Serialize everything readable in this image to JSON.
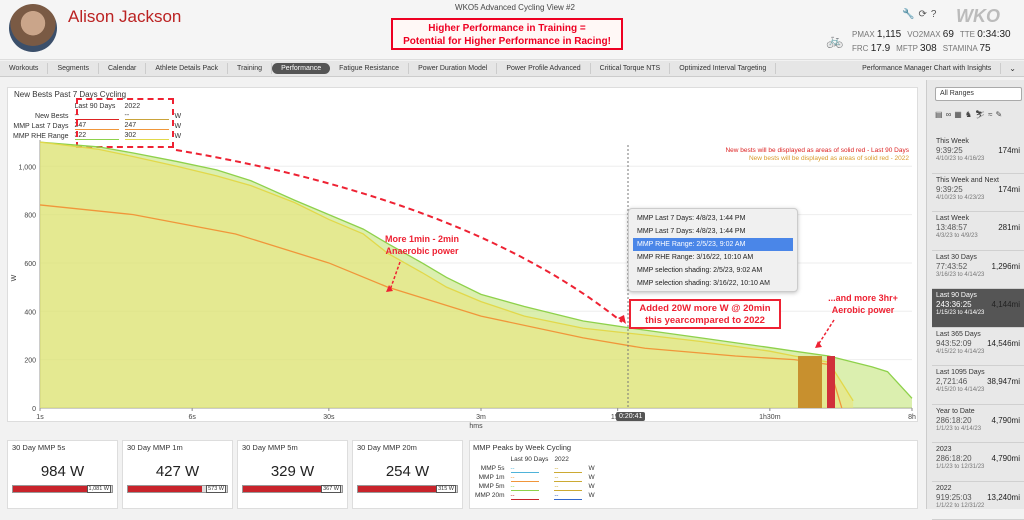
{
  "window_title": "WKO5 Advanced Cycling View #2",
  "athlete": {
    "name": "Alison Jackson"
  },
  "headline": {
    "line1": "Higher Performance in Training =",
    "line2": "Potential for Higher Performance in Racing!"
  },
  "logo": "WKO",
  "metrics": [
    {
      "label": "PMAX",
      "value": "1,115"
    },
    {
      "label": "VO2MAX",
      "value": "69"
    },
    {
      "label": "TTE",
      "value": "0:34:30"
    },
    {
      "label": "FRC",
      "value": "17.9"
    },
    {
      "label": "MFTP",
      "value": "308"
    },
    {
      "label": "STAMINA",
      "value": "75"
    }
  ],
  "tabs": [
    "Workouts",
    "Segments",
    "Calendar",
    "Athlete Details Pack",
    "Training",
    "Performance",
    "Fatigue Resistance",
    "Power Duration Model",
    "Power Profile Advanced",
    "Critical Torque NTS",
    "Optimized Interval Targeting",
    "Performance Manager Chart with Insights"
  ],
  "active_tab": "Performance",
  "main_chart": {
    "panel_title": "New Bests Past 7 Days Cycling",
    "legend": {
      "col1": "Last 90 Days",
      "col2": "2022",
      "rows": [
        {
          "label": "New Bests",
          "v1": "--",
          "v2": "--",
          "unit": "W"
        },
        {
          "label": "MMP Last 7 Days",
          "v1": "247",
          "v2": "247",
          "unit": "W"
        },
        {
          "label": "MMP RHE Range",
          "v1": "322",
          "v2": "302",
          "unit": "W"
        }
      ]
    },
    "notes": [
      "New bests will be displayed as areas of solid red - Last 90 Days",
      "New bests will be displayed as areas of solid red - 2022"
    ],
    "annotations": {
      "anaerobic": [
        "More 1min - 2min",
        "Anaerobic power"
      ],
      "threshold": [
        "Added 20W more W @ 20min",
        "this yearcompared to 2022"
      ],
      "aerobic": [
        "...and more 3hr+",
        "Aerobic power"
      ]
    },
    "tooltip_items": [
      "MMP Last 7 Days: 4/8/23, 1:44 PM",
      "MMP Last 7 Days: 4/8/23, 1:44 PM",
      "MMP RHE Range: 2/5/23, 9:02 AM",
      "MMP RHE Range: 3/16/22, 10:10 AM",
      "MMP selection shading: 2/5/23, 9:02 AM",
      "MMP selection shading: 3/16/22, 10:10 AM"
    ],
    "tooltip_selected": 2,
    "cursor_time": "0:20:41"
  },
  "chart_data": {
    "type": "area",
    "xlabel": "hms",
    "ylabel": "W",
    "x_ticks": [
      "1s",
      "6s",
      "30s",
      "3m",
      "15m",
      "1h30m",
      "8h"
    ],
    "y_ticks": [
      "0",
      "200",
      "400",
      "600",
      "800",
      "1,000"
    ],
    "ylim": [
      0,
      1150
    ],
    "x_log_seconds": [
      1,
      28800
    ],
    "series": [
      {
        "name": "MMP RHE Range - Last 90 Days",
        "color": "#8ed14b",
        "x": [
          1,
          2,
          3,
          5,
          8,
          12,
          20,
          30,
          45,
          60,
          90,
          120,
          180,
          300,
          600,
          1241,
          2400,
          3600,
          5400,
          7200,
          10800,
          14400,
          18000,
          21600,
          28800
        ],
        "y": [
          1100,
          1080,
          1055,
          1020,
          985,
          940,
          860,
          800,
          740,
          680,
          600,
          540,
          470,
          420,
          360,
          322,
          290,
          270,
          250,
          235,
          215,
          190,
          170,
          150,
          40
        ]
      },
      {
        "name": "MMP RHE Range - 2022",
        "color": "#e2d84a",
        "x": [
          1,
          2,
          3,
          5,
          8,
          12,
          20,
          30,
          45,
          60,
          90,
          120,
          180,
          300,
          600,
          1241,
          2400,
          3600,
          5400,
          7200,
          10800,
          14400
        ],
        "y": [
          1100,
          1070,
          1040,
          1000,
          960,
          920,
          850,
          780,
          720,
          640,
          560,
          500,
          440,
          380,
          330,
          302,
          275,
          255,
          235,
          215,
          190,
          30
        ]
      },
      {
        "name": "MMP Last 7 Days",
        "color": "#f0963a",
        "x": [
          1,
          3,
          10,
          30,
          60,
          180,
          600,
          1241,
          3600,
          7200,
          10800,
          12600
        ],
        "y": [
          840,
          800,
          720,
          600,
          500,
          380,
          290,
          247,
          215,
          200,
          180,
          0
        ]
      }
    ]
  },
  "stat_cards": [
    {
      "title": "30 Day MMP 5s",
      "value": "984 W",
      "bar_label": "1,081 W",
      "fill": 0.91
    },
    {
      "title": "30 Day MMP 1m",
      "value": "427 W",
      "bar_label": "573 W",
      "fill": 0.75
    },
    {
      "title": "30 Day MMP 5m",
      "value": "329 W",
      "bar_label": "367 W",
      "fill": 0.9
    },
    {
      "title": "30 Day MMP 20m",
      "value": "254 W",
      "bar_label": "315 W",
      "fill": 0.81
    }
  ],
  "peaks": {
    "title": "MMP Peaks by Week Cycling",
    "col1": "Last 90 Days",
    "col2": "2022",
    "rows": [
      {
        "label": "MMP 5s",
        "c1": "#4fb3d9",
        "c2": "#ccaa33",
        "unit": "W"
      },
      {
        "label": "MMP 1m",
        "c1": "#f0963a",
        "c2": "#ccaa33",
        "unit": "W"
      },
      {
        "label": "MMP 5m",
        "c1": "#8ed14b",
        "c2": "#ccaa33",
        "unit": "W"
      },
      {
        "label": "MMP 20m",
        "c1": "#c8232b",
        "c2": "#3366cc",
        "unit": "W"
      }
    ]
  },
  "sidebar": {
    "select_value": "All Ranges",
    "ranges": [
      {
        "name": "This Week",
        "dur": "9:39:25",
        "dist": "174mi",
        "dates": "4/10/23 to 4/16/23"
      },
      {
        "name": "This Week and Next",
        "dur": "9:39:25",
        "dist": "174mi",
        "dates": "4/10/23 to 4/23/23"
      },
      {
        "name": "Last Week",
        "dur": "13:48:57",
        "dist": "281mi",
        "dates": "4/3/23 to 4/9/23"
      },
      {
        "name": "Last 30 Days",
        "dur": "77:43:52",
        "dist": "1,296mi",
        "dates": "3/16/23 to 4/14/23"
      },
      {
        "name": "Last 90 Days",
        "dur": "243:36:25",
        "dist": "4,144mi",
        "dates": "1/15/23 to 4/14/23"
      },
      {
        "name": "Last 365 Days",
        "dur": "943:52:09",
        "dist": "14,546mi",
        "dates": "4/15/22 to 4/14/23"
      },
      {
        "name": "Last 1095 Days",
        "dur": "2,721:46",
        "dist": "38,947mi",
        "dates": "4/15/20 to 4/14/23"
      },
      {
        "name": "Year to Date",
        "dur": "286:18:20",
        "dist": "4,790mi",
        "dates": "1/1/23 to 4/14/23"
      },
      {
        "name": "2023",
        "dur": "286:18:20",
        "dist": "4,790mi",
        "dates": "1/1/23 to 12/31/23"
      },
      {
        "name": "2022",
        "dur": "919:25:03",
        "dist": "13,240mi",
        "dates": "1/1/22 to 12/31/22"
      }
    ]
  }
}
